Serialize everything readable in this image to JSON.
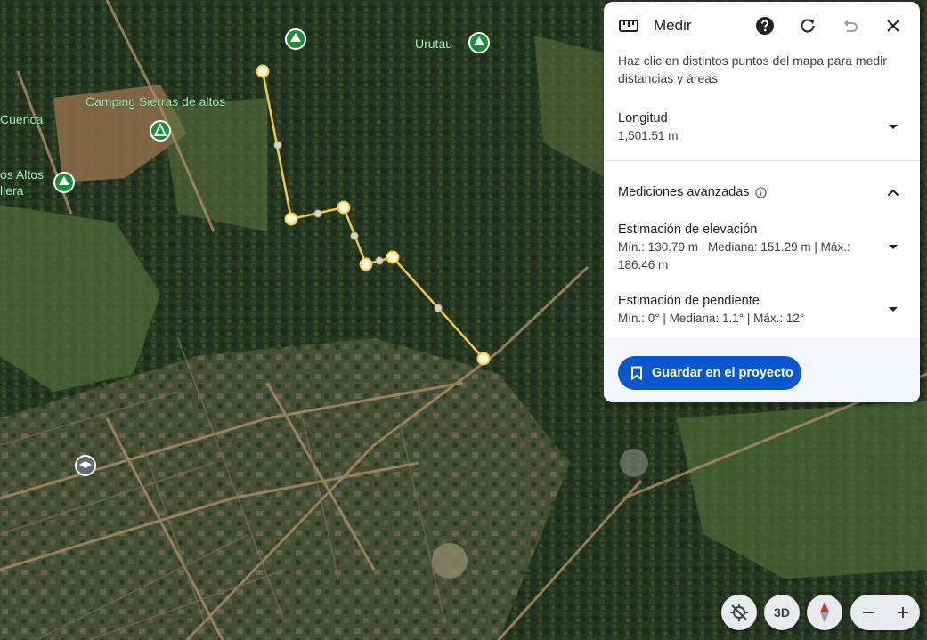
{
  "map": {
    "places": [
      {
        "id": "urutau",
        "label": "Urutau"
      },
      {
        "id": "camping",
        "label": "Camping Sierras de altos"
      },
      {
        "id": "cuenca",
        "label": "Cuenca"
      },
      {
        "id": "altos",
        "label": "os Altos"
      },
      {
        "id": "llera",
        "label": "llera"
      }
    ],
    "colors": {
      "measure_line": "#f2c84b",
      "park_pin": "#1e8e3e",
      "school_pin": "#5f6b7a"
    }
  },
  "panel": {
    "title": "Medir",
    "icons": {
      "tool": "ruler-icon",
      "help": "help-icon",
      "reset": "refresh-icon",
      "undo": "undo-icon",
      "close": "close-icon"
    },
    "instructions": "Haz clic en distintos puntos del mapa para medir distancias y áreas",
    "length": {
      "label": "Longitud",
      "value": "1,501.51 m"
    },
    "advanced": {
      "label": "Mediciones avanzadas"
    },
    "elevation": {
      "label": "Estimación de elevación",
      "value": "Mín.: 130.79 m | Mediana: 151.29 m | Máx.: 186.46 m"
    },
    "slope": {
      "label": "Estimación de pendiente",
      "value": "Mín.: 0° | Mediana: 1.1° | Máx.: 12°"
    },
    "save_label": "Guardar en el proyecto",
    "accent": "#0b57d0"
  },
  "controls": {
    "three_d_label": "3D"
  }
}
